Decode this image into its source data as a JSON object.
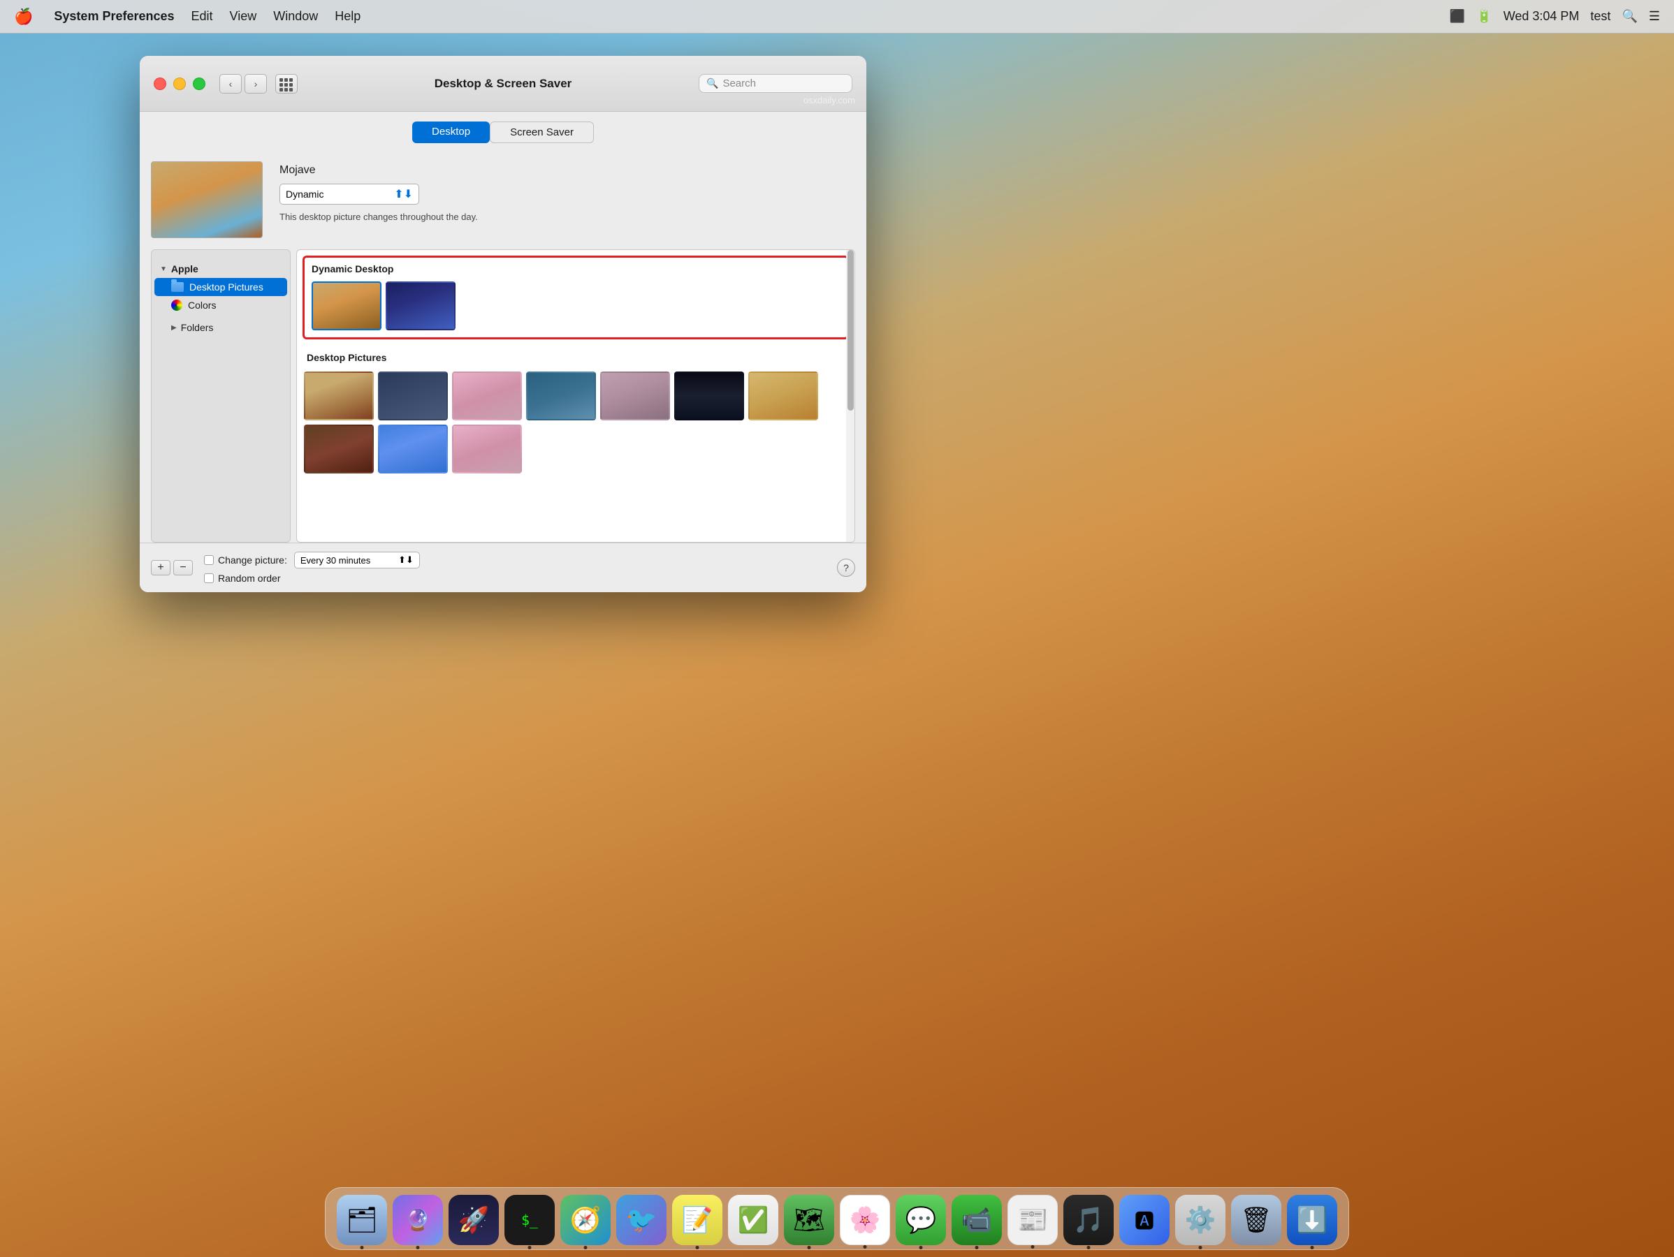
{
  "menubar": {
    "apple_logo": "🍎",
    "app_name": "System Preferences",
    "menus": [
      "Edit",
      "View",
      "Window",
      "Help"
    ],
    "right": {
      "time": "Wed 3:04 PM",
      "user": "test"
    }
  },
  "window": {
    "title": "Desktop & Screen Saver",
    "search_placeholder": "Search",
    "watermark": "osxdaily.com",
    "tabs": [
      {
        "label": "Desktop",
        "active": true
      },
      {
        "label": "Screen Saver",
        "active": false
      }
    ],
    "preview": {
      "wallpaper_name": "Mojave",
      "dropdown_value": "Dynamic",
      "description": "This desktop picture changes throughout the day."
    },
    "sidebar": {
      "groups": [
        {
          "name": "Apple",
          "expanded": true,
          "items": [
            {
              "label": "Desktop Pictures",
              "type": "folder",
              "selected": true
            },
            {
              "label": "Colors",
              "type": "colors",
              "selected": false
            }
          ]
        }
      ],
      "folders": {
        "label": "Folders",
        "expanded": false
      },
      "add_button": "+",
      "remove_button": "−"
    },
    "gallery": {
      "dynamic_section": {
        "label": "Dynamic Desktop",
        "highlighted": true
      },
      "desktop_pictures_section": {
        "label": "Desktop Pictures"
      }
    },
    "bottom_bar": {
      "change_picture_label": "Change picture:",
      "interval_value": "Every 30 minutes",
      "random_order_label": "Random order",
      "help_label": "?"
    }
  },
  "dock": {
    "icons": [
      {
        "name": "Finder",
        "emoji": "🗂"
      },
      {
        "name": "Siri",
        "emoji": "🔮"
      },
      {
        "name": "Launchpad",
        "emoji": "🚀"
      },
      {
        "name": "Terminal",
        "emoji": ">_"
      },
      {
        "name": "Safari",
        "emoji": "🧭"
      },
      {
        "name": "Bird",
        "emoji": "🐦"
      },
      {
        "name": "Notes",
        "emoji": "📝"
      },
      {
        "name": "Reminders",
        "emoji": "☑️"
      },
      {
        "name": "Maps",
        "emoji": "🗺"
      },
      {
        "name": "Photos",
        "emoji": "🌸"
      },
      {
        "name": "Messages",
        "emoji": "💬"
      },
      {
        "name": "FaceTime",
        "emoji": "📹"
      },
      {
        "name": "News",
        "emoji": "📰"
      },
      {
        "name": "Music",
        "emoji": "🎵"
      },
      {
        "name": "App Store",
        "emoji": "🅰"
      },
      {
        "name": "System Prefs",
        "emoji": "⚙️"
      },
      {
        "name": "Trash",
        "emoji": "🗑"
      },
      {
        "name": "Downloads",
        "emoji": "⬇️"
      }
    ]
  }
}
